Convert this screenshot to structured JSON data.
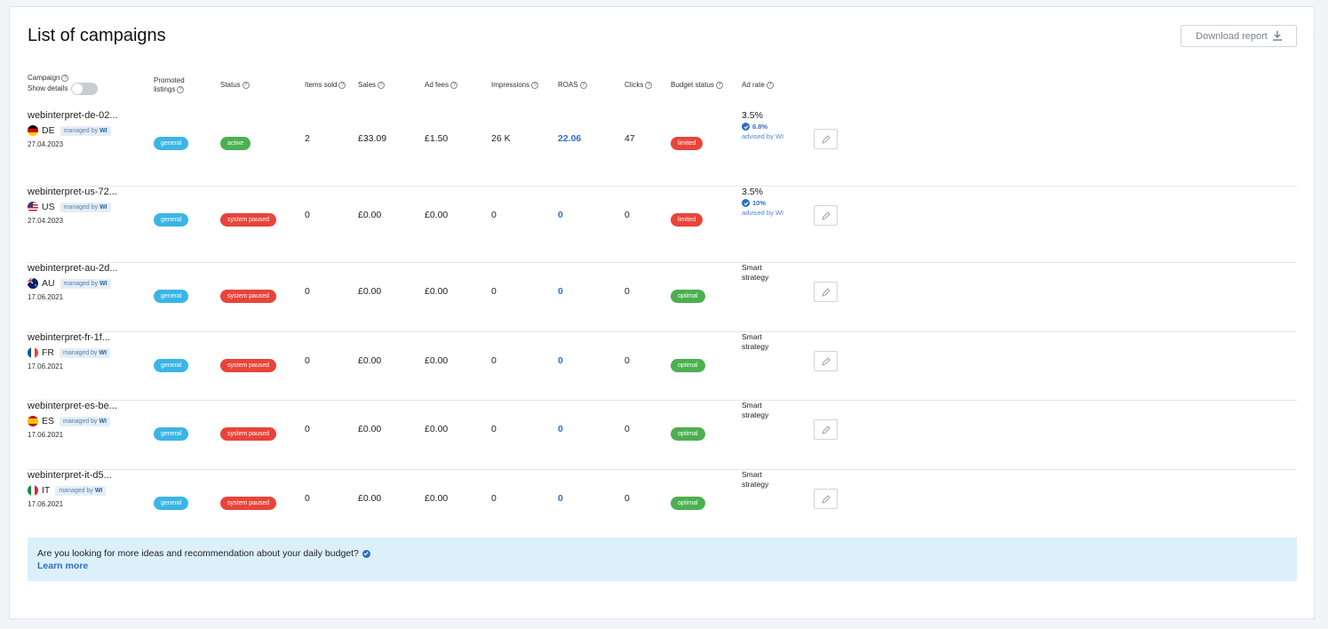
{
  "page": {
    "title": "List of campaigns",
    "download_label": "Download report",
    "download_icon": "download-icon"
  },
  "headers": {
    "campaign": "Campaign",
    "show_details": "Show details",
    "promoted_line1": "Promoted",
    "promoted_line2": "listings",
    "status": "Status",
    "items_sold": "Items sold",
    "sales": "Sales",
    "ad_fees": "Ad fees",
    "impressions": "Impressions",
    "roas": "ROAS",
    "clicks": "Clicks",
    "budget_status": "Budget status",
    "ad_rate": "Ad rate"
  },
  "managed": {
    "prefix": "managed by",
    "brand": "WI"
  },
  "colors": {
    "general": "#3ab5e6",
    "active": "#4caf50",
    "paused": "#e8443a",
    "limited": "#e8443a",
    "optimal": "#4caf50",
    "link": "#2d6ec8"
  },
  "campaigns": [
    {
      "name": "webinterpret-de-02...",
      "country": "DE",
      "date": "27.04.2023",
      "promoted": "general",
      "status": "active",
      "items_sold": "2",
      "sales": "£33.09",
      "ad_fees": "£1.50",
      "impressions": "26 K",
      "roas": "22.06",
      "clicks": "47",
      "budget_status": "limited",
      "ad_rate": "3.5%",
      "advised_pct": "6.8%",
      "advised_by": "advised by WI"
    },
    {
      "name": "webinterpret-us-72...",
      "country": "US",
      "date": "27.04.2023",
      "promoted": "general",
      "status": "system paused",
      "items_sold": "0",
      "sales": "£0.00",
      "ad_fees": "£0.00",
      "impressions": "0",
      "roas": "0",
      "clicks": "0",
      "budget_status": "limited",
      "ad_rate": "3.5%",
      "advised_pct": "10%",
      "advised_by": "advised by WI"
    },
    {
      "name": "webinterpret-au-2d...",
      "country": "AU",
      "date": "17.06.2021",
      "promoted": "general",
      "status": "system paused",
      "items_sold": "0",
      "sales": "£0.00",
      "ad_fees": "£0.00",
      "impressions": "0",
      "roas": "0",
      "clicks": "0",
      "budget_status": "optimal",
      "smart_line1": "Smart",
      "smart_line2": "strategy"
    },
    {
      "name": "webinterpret-fr-1f...",
      "country": "FR",
      "date": "17.06.2021",
      "promoted": "general",
      "status": "system paused",
      "items_sold": "0",
      "sales": "£0.00",
      "ad_fees": "£0.00",
      "impressions": "0",
      "roas": "0",
      "clicks": "0",
      "budget_status": "optimal",
      "smart_line1": "Smart",
      "smart_line2": "strategy"
    },
    {
      "name": "webinterpret-es-be...",
      "country": "ES",
      "date": "17.06.2021",
      "promoted": "general",
      "status": "system paused",
      "items_sold": "0",
      "sales": "£0.00",
      "ad_fees": "£0.00",
      "impressions": "0",
      "roas": "0",
      "clicks": "0",
      "budget_status": "optimal",
      "smart_line1": "Smart",
      "smart_line2": "strategy"
    },
    {
      "name": "webinterpret-it-d5...",
      "country": "IT",
      "date": "17.06.2021",
      "promoted": "general",
      "status": "system paused",
      "items_sold": "0",
      "sales": "£0.00",
      "ad_fees": "£0.00",
      "impressions": "0",
      "roas": "0",
      "clicks": "0",
      "budget_status": "optimal",
      "smart_line1": "Smart",
      "smart_line2": "strategy"
    }
  ],
  "banner": {
    "text": "Are you looking for more ideas and recommendation about your daily budget?",
    "link": "Learn more"
  }
}
